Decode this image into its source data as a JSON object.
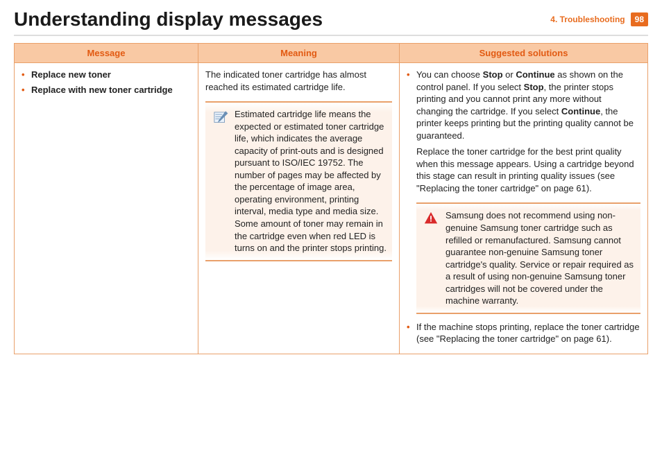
{
  "header": {
    "title": "Understanding display messages",
    "section": "4.  Troubleshooting",
    "page_number": "98"
  },
  "table": {
    "headers": {
      "message": "Message",
      "meaning": "Meaning",
      "solutions": "Suggested solutions"
    },
    "row": {
      "messages": [
        "Replace new toner",
        "Replace with new toner cartridge"
      ],
      "meaning_intro": "The indicated toner cartridge has almost reached its estimated cartridge life.",
      "meaning_note": "Estimated cartridge life means the expected or estimated toner cartridge life, which indicates the average capacity of print-outs and is designed pursuant to ISO/IEC 19752. The number of pages may be affected by the percentage of image area, operating environment, printing interval, media type and media size. Some amount of toner may remain in the cartridge even when red LED is turns on and the printer stops printing.",
      "solution_bullet1_pre": "You can choose ",
      "solution_bullet1_stop": "Stop",
      "solution_bullet1_mid1": " or ",
      "solution_bullet1_continue": "Continue",
      "solution_bullet1_mid2": " as shown on the control panel. If you select ",
      "solution_bullet1_mid3": ", the printer stops printing and you cannot print any more without changing the cartridge. If you select ",
      "solution_bullet1_tail": ", the printer keeps printing but the printing quality cannot be guaranteed.",
      "solution_para2": "Replace the toner cartridge for the best print quality when this message appears. Using a cartridge beyond this stage can result in printing quality issues (see \"Replacing the toner cartridge\" on page 61).",
      "solution_warning": "Samsung does not recommend using non-genuine Samsung toner cartridge such as refilled or remanufactured. Samsung cannot guarantee non-genuine Samsung toner cartridge's quality. Service or repair required as a result of using non-genuine Samsung toner cartridges will not be covered under the machine warranty.",
      "solution_bullet2": "If the machine stops printing, replace the toner cartridge (see \"Replacing the toner cartridge\" on page 61)."
    }
  },
  "icons": {
    "note": "note-icon",
    "warning": "warning-icon"
  }
}
